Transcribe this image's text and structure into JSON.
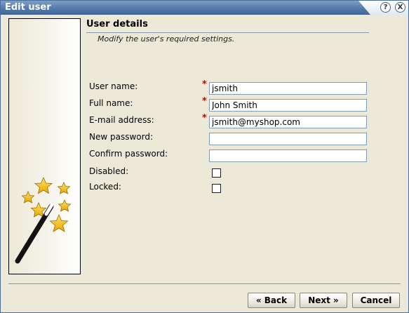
{
  "window": {
    "title": "Edit user",
    "help_icon_glyph": "?",
    "close_icon_glyph": "X"
  },
  "sidebar": {
    "image": "magic-wand-with-stars"
  },
  "section": {
    "title": "User details",
    "description": "Modify the user's required settings."
  },
  "form": {
    "required_marker": "*",
    "fields": [
      {
        "label": "User name:",
        "value": "jsmith",
        "required": true
      },
      {
        "label": "Full name:",
        "value": "John Smith",
        "required": true
      },
      {
        "label": "E-mail address:",
        "value": "jsmith@myshop.com",
        "required": true
      },
      {
        "label": "New password:",
        "value": "",
        "required": false
      },
      {
        "label": "Confirm password:",
        "value": "",
        "required": false
      }
    ],
    "checkboxes": [
      {
        "label": "Disabled:",
        "checked": false
      },
      {
        "label": "Locked:",
        "checked": false
      }
    ]
  },
  "footer": {
    "back_label": "« Back",
    "next_label": "Next »",
    "cancel_label": "Cancel"
  },
  "colors": {
    "title_bar": "#557aa9",
    "required_star": "#d10000",
    "window_bg": "#ece9d8",
    "star_fill": "#f6c31c"
  }
}
